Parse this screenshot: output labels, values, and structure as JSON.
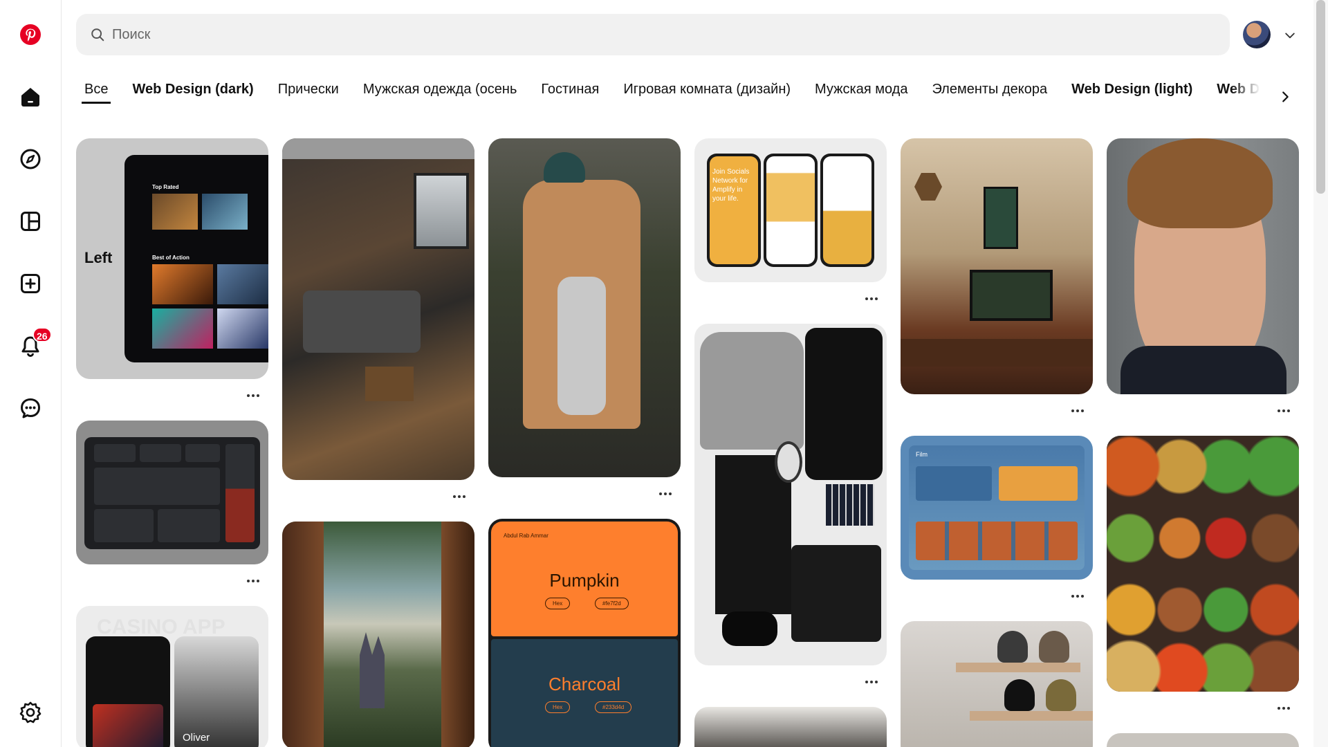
{
  "search": {
    "placeholder": "Поиск",
    "icon": "search-icon"
  },
  "sidebar": {
    "items": [
      {
        "name": "pinterest-logo",
        "icon": "pinterest-icon"
      },
      {
        "name": "home",
        "icon": "home-icon"
      },
      {
        "name": "explore",
        "icon": "compass-icon"
      },
      {
        "name": "boards",
        "icon": "boards-icon"
      },
      {
        "name": "create",
        "icon": "plus-icon"
      },
      {
        "name": "notifications",
        "icon": "bell-icon",
        "badge": "26"
      },
      {
        "name": "messages",
        "icon": "chat-icon"
      },
      {
        "name": "settings",
        "icon": "gear-icon"
      }
    ]
  },
  "tabs": [
    {
      "label": "Все",
      "active": true
    },
    {
      "label": "Web Design (dark)",
      "bold": true
    },
    {
      "label": "Прически"
    },
    {
      "label": "Мужская одежда (осень"
    },
    {
      "label": "Гостиная"
    },
    {
      "label": "Игровая комната (дизайн)"
    },
    {
      "label": "Мужская мода"
    },
    {
      "label": "Элементы декора"
    },
    {
      "label": "Web Design (light)",
      "bold": true
    },
    {
      "label": "Web Design (i",
      "bold": true
    }
  ],
  "pins": {
    "streaming_label": "Left",
    "streaming_top_rated": "Top Rated",
    "streaming_best": "Best of Action",
    "social_text": "Join Socials Network for Amplify in your life.",
    "pumpkin": {
      "name": "Pumpkin",
      "hex_label": "Hex",
      "hex": "#fe7f2d",
      "author": "Abdul Rab Ammar"
    },
    "charcoal": {
      "name": "Charcoal",
      "hex_label": "Hex",
      "hex": "#233d4d"
    },
    "casino_title": "CASINO APP",
    "casino_name": "Oliver",
    "film_title": "Film"
  },
  "colors": {
    "brand": "#e60023",
    "pumpkin": "#fe7f2d",
    "charcoal": "#233d4d"
  }
}
